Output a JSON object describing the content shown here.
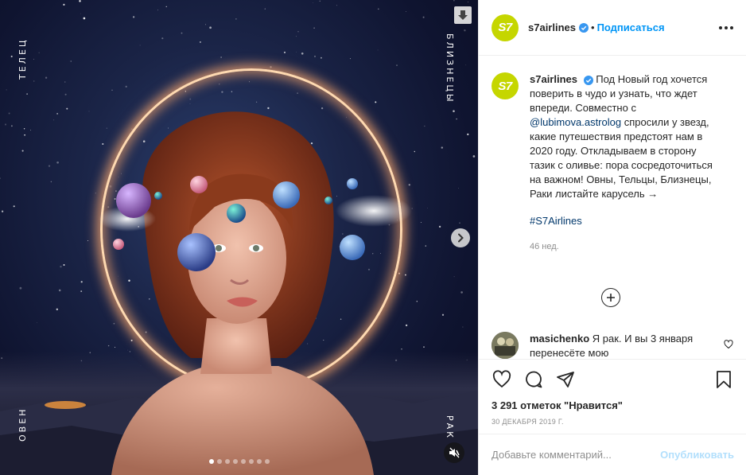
{
  "media": {
    "zodiac": {
      "left_top": "ТЕЛЕЦ",
      "right_top": "БЛИЗНЕЦЫ",
      "left_bottom": "ОВЕН",
      "right_bottom": "РАК"
    },
    "carousel": {
      "total": 8,
      "current": 1
    },
    "icons": {
      "save": "download-arrow-icon",
      "next": "chevron-right-icon",
      "mute": "speaker-muted-icon"
    }
  },
  "header": {
    "avatar_text": "S7",
    "username": "s7airlines",
    "separator": "•",
    "follow_label": "Подписаться",
    "brand_color": "#c5d600",
    "verified_color": "#0095f6"
  },
  "caption": {
    "username": "s7airlines",
    "text_before_mention": "Под Новый год хочется поверить в чудо и узнать, что ждет впереди. Совместно с",
    "mention": "@lubimova.astrolog",
    "text_after_mention": "спросили у звезд, какие путешествия предстоят нам в 2020 году. Откладываем в сторону тазик с оливье: пора сосредоточиться на важном! Овны, Тельцы, Близнецы, Раки листайте карусель →",
    "hashtag": "#S7Airlines",
    "time_ago": "46 нед."
  },
  "comment": {
    "username": "masichenko",
    "text": "Я рак. И вы 3 января перенесёте мою"
  },
  "actions": {
    "likes": "3 291 отметок \"Нравится\"",
    "date": "30 ДЕКАБРЯ 2019 Г."
  },
  "add_comment": {
    "placeholder": "Добавьте комментарий...",
    "publish_label": "Опубликовать"
  }
}
